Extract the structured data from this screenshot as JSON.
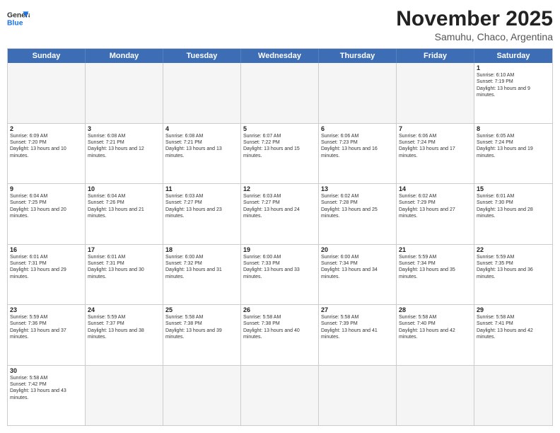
{
  "logo": {
    "text_general": "General",
    "text_blue": "Blue"
  },
  "title": "November 2025",
  "subtitle": "Samuhu, Chaco, Argentina",
  "weekdays": [
    "Sunday",
    "Monday",
    "Tuesday",
    "Wednesday",
    "Thursday",
    "Friday",
    "Saturday"
  ],
  "weeks": [
    [
      {
        "day": "",
        "empty": true
      },
      {
        "day": "",
        "empty": true
      },
      {
        "day": "",
        "empty": true
      },
      {
        "day": "",
        "empty": true
      },
      {
        "day": "",
        "empty": true
      },
      {
        "day": "",
        "empty": true
      },
      {
        "day": "1",
        "sunrise": "6:10 AM",
        "sunset": "7:19 PM",
        "daylight": "13 hours and 9 minutes."
      }
    ],
    [
      {
        "day": "2",
        "sunrise": "6:09 AM",
        "sunset": "7:20 PM",
        "daylight": "13 hours and 10 minutes."
      },
      {
        "day": "3",
        "sunrise": "6:08 AM",
        "sunset": "7:21 PM",
        "daylight": "13 hours and 12 minutes."
      },
      {
        "day": "4",
        "sunrise": "6:08 AM",
        "sunset": "7:21 PM",
        "daylight": "13 hours and 13 minutes."
      },
      {
        "day": "5",
        "sunrise": "6:07 AM",
        "sunset": "7:22 PM",
        "daylight": "13 hours and 15 minutes."
      },
      {
        "day": "6",
        "sunrise": "6:06 AM",
        "sunset": "7:23 PM",
        "daylight": "13 hours and 16 minutes."
      },
      {
        "day": "7",
        "sunrise": "6:06 AM",
        "sunset": "7:24 PM",
        "daylight": "13 hours and 17 minutes."
      },
      {
        "day": "8",
        "sunrise": "6:05 AM",
        "sunset": "7:24 PM",
        "daylight": "13 hours and 19 minutes."
      }
    ],
    [
      {
        "day": "9",
        "sunrise": "6:04 AM",
        "sunset": "7:25 PM",
        "daylight": "13 hours and 20 minutes."
      },
      {
        "day": "10",
        "sunrise": "6:04 AM",
        "sunset": "7:26 PM",
        "daylight": "13 hours and 21 minutes."
      },
      {
        "day": "11",
        "sunrise": "6:03 AM",
        "sunset": "7:27 PM",
        "daylight": "13 hours and 23 minutes."
      },
      {
        "day": "12",
        "sunrise": "6:03 AM",
        "sunset": "7:27 PM",
        "daylight": "13 hours and 24 minutes."
      },
      {
        "day": "13",
        "sunrise": "6:02 AM",
        "sunset": "7:28 PM",
        "daylight": "13 hours and 25 minutes."
      },
      {
        "day": "14",
        "sunrise": "6:02 AM",
        "sunset": "7:29 PM",
        "daylight": "13 hours and 27 minutes."
      },
      {
        "day": "15",
        "sunrise": "6:01 AM",
        "sunset": "7:30 PM",
        "daylight": "13 hours and 28 minutes."
      }
    ],
    [
      {
        "day": "16",
        "sunrise": "6:01 AM",
        "sunset": "7:31 PM",
        "daylight": "13 hours and 29 minutes."
      },
      {
        "day": "17",
        "sunrise": "6:01 AM",
        "sunset": "7:31 PM",
        "daylight": "13 hours and 30 minutes."
      },
      {
        "day": "18",
        "sunrise": "6:00 AM",
        "sunset": "7:32 PM",
        "daylight": "13 hours and 31 minutes."
      },
      {
        "day": "19",
        "sunrise": "6:00 AM",
        "sunset": "7:33 PM",
        "daylight": "13 hours and 33 minutes."
      },
      {
        "day": "20",
        "sunrise": "6:00 AM",
        "sunset": "7:34 PM",
        "daylight": "13 hours and 34 minutes."
      },
      {
        "day": "21",
        "sunrise": "5:59 AM",
        "sunset": "7:34 PM",
        "daylight": "13 hours and 35 minutes."
      },
      {
        "day": "22",
        "sunrise": "5:59 AM",
        "sunset": "7:35 PM",
        "daylight": "13 hours and 36 minutes."
      }
    ],
    [
      {
        "day": "23",
        "sunrise": "5:59 AM",
        "sunset": "7:36 PM",
        "daylight": "13 hours and 37 minutes."
      },
      {
        "day": "24",
        "sunrise": "5:59 AM",
        "sunset": "7:37 PM",
        "daylight": "13 hours and 38 minutes."
      },
      {
        "day": "25",
        "sunrise": "5:58 AM",
        "sunset": "7:38 PM",
        "daylight": "13 hours and 39 minutes."
      },
      {
        "day": "26",
        "sunrise": "5:58 AM",
        "sunset": "7:38 PM",
        "daylight": "13 hours and 40 minutes."
      },
      {
        "day": "27",
        "sunrise": "5:58 AM",
        "sunset": "7:39 PM",
        "daylight": "13 hours and 41 minutes."
      },
      {
        "day": "28",
        "sunrise": "5:58 AM",
        "sunset": "7:40 PM",
        "daylight": "13 hours and 42 minutes."
      },
      {
        "day": "29",
        "sunrise": "5:58 AM",
        "sunset": "7:41 PM",
        "daylight": "13 hours and 42 minutes."
      }
    ],
    [
      {
        "day": "30",
        "sunrise": "5:58 AM",
        "sunset": "7:42 PM",
        "daylight": "13 hours and 43 minutes."
      },
      {
        "day": "",
        "empty": true
      },
      {
        "day": "",
        "empty": true
      },
      {
        "day": "",
        "empty": true
      },
      {
        "day": "",
        "empty": true
      },
      {
        "day": "",
        "empty": true
      },
      {
        "day": "",
        "empty": true
      }
    ]
  ]
}
